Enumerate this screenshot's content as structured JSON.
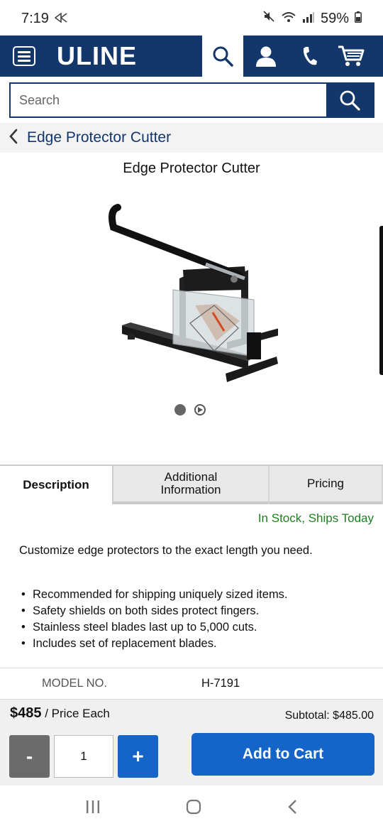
{
  "status_bar": {
    "time": "7:19",
    "battery": "59%"
  },
  "header": {
    "logo": "ULINE",
    "icons": [
      "menu-icon",
      "search-icon",
      "account-icon",
      "phone-icon",
      "cart-icon"
    ],
    "brand_color": "#13366b"
  },
  "search": {
    "placeholder": "Search"
  },
  "breadcrumb": {
    "label": "Edge Protector Cutter"
  },
  "product": {
    "title": "Edge Protector Cutter",
    "image_count": 2
  },
  "tabs": [
    {
      "label": "Description",
      "active": true
    },
    {
      "label": "Additional Information",
      "active": false
    },
    {
      "label": "Pricing",
      "active": false
    }
  ],
  "availability": "In Stock, Ships Today",
  "description": "Customize edge protectors to the exact length you need.",
  "features": [
    "Recommended for shipping uniquely sized items.",
    "Safety shields on both sides protect fingers.",
    "Stainless steel blades last up to 5,000 cuts.",
    "Includes set of replacement blades."
  ],
  "model": {
    "label": "MODEL NO.",
    "value": "H-7191"
  },
  "cart": {
    "price": "$485",
    "price_note": " / Price Each",
    "subtotal": "Subtotal: $485.00",
    "minus_label": "-",
    "quantity": "1",
    "plus_label": "+",
    "add_label": "Add to Cart",
    "accent_color": "#1565c8",
    "stock_color": "#1e7f1e"
  }
}
